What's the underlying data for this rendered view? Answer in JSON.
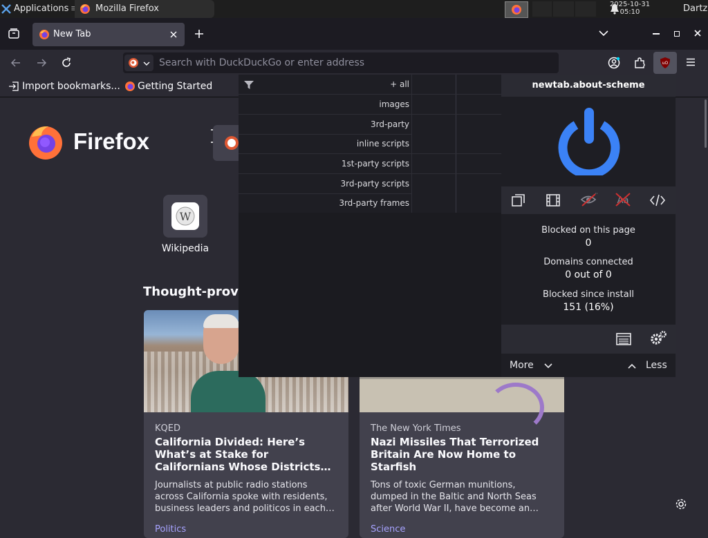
{
  "system_panel": {
    "applications_label": "Applications",
    "task_title": "Mozilla Firefox",
    "clock_date": "2025-10-31",
    "clock_time": "05:10",
    "user": "Dartz"
  },
  "tabs": [
    {
      "label": "New Tab"
    }
  ],
  "urlbar": {
    "placeholder": "Search with DuckDuckGo or enter address"
  },
  "bookmarks": [
    {
      "label": "Import bookmarks..."
    },
    {
      "label": "Getting Started"
    }
  ],
  "newtab": {
    "brand": "Firefox",
    "shortcuts": [
      {
        "label": "Wikipedia"
      }
    ],
    "section_title": "Thought-provo",
    "stories": [
      {
        "source": "KQED",
        "title": "California Divided: Here’s What’s at Stake for Californians Whose Districts…",
        "excerpt": "Journalists at public radio stations across California spoke with residents, business leaders and politicos in each…",
        "category": "Politics"
      },
      {
        "source": "The New York Times",
        "title": "Nazi Missiles That Terrorized Britain Are Now Home to Starfish",
        "excerpt": "Tons of toxic German munitions, dumped in the Baltic and North Seas after World War II, have become an…",
        "category": "Science"
      }
    ]
  },
  "ubo": {
    "hostname": "newtab.about-scheme",
    "filter_rows": [
      {
        "label": "+ all"
      },
      {
        "label": "images"
      },
      {
        "label": "3rd-party"
      },
      {
        "label": "inline scripts"
      },
      {
        "label": "1st-party scripts"
      },
      {
        "label": "3rd-party scripts"
      },
      {
        "label": "3rd-party frames"
      }
    ],
    "stats": {
      "blocked_page_label": "Blocked on this page",
      "blocked_page_value": "0",
      "domains_label": "Domains connected",
      "domains_value": "0 out of 0",
      "blocked_install_label": "Blocked since install",
      "blocked_install_value": "151 (16%)"
    },
    "more_label": "More",
    "less_label": "Less",
    "accent": "#3b82f6"
  }
}
